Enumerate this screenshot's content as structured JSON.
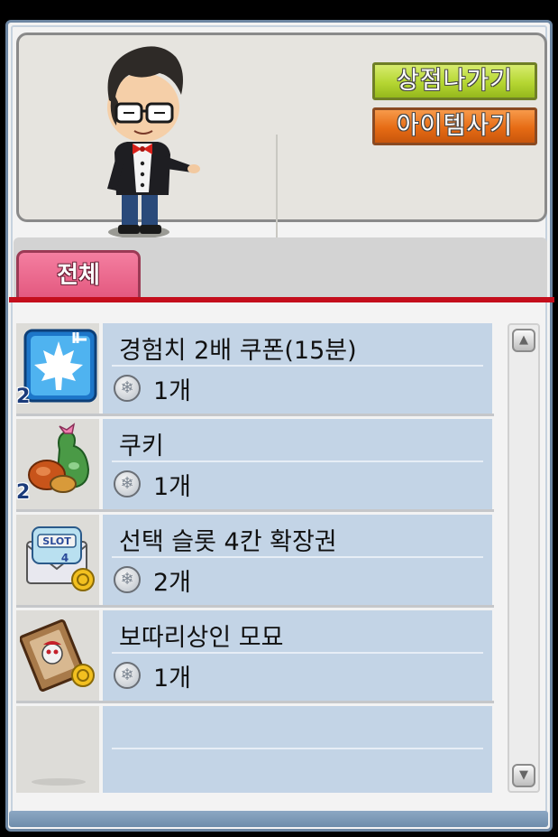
{
  "npc": {
    "exit_label": "상점나가기",
    "buy_label": "아이템사기"
  },
  "tabs": [
    {
      "label": "전체",
      "selected": true
    }
  ],
  "items": [
    {
      "name": "경험치 2배 쿠폰(15분)",
      "price": "1개",
      "badge": "2",
      "icon": "maple-leaf-coupon-icon"
    },
    {
      "name": "쿠키",
      "price": "1개",
      "badge": "2",
      "icon": "cookie-bag-icon"
    },
    {
      "name": "선택 슬롯 4칸 확장권",
      "price": "2개",
      "badge": "",
      "icon": "slot-expansion-ticket-icon",
      "slot_text": "SLOT",
      "slot_num": "4"
    },
    {
      "name": "보따리상인 모묘",
      "price": "1개",
      "badge": "",
      "icon": "merchant-card-icon"
    },
    {
      "name": "",
      "price": "",
      "badge": "",
      "icon": "empty-slot"
    }
  ],
  "colors": {
    "accent_red": "#c40e1c",
    "tab_pink": "#e2567d",
    "row_blue": "#c3d4e6",
    "exit_green": "#b5d632",
    "buy_orange": "#e66b14"
  }
}
